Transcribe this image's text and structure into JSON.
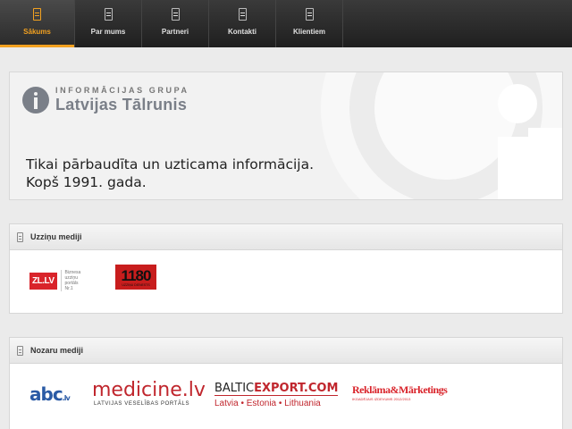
{
  "nav": {
    "items": [
      {
        "label": "Sākums",
        "icon": "page-icon",
        "active": true
      },
      {
        "label": "Par mums",
        "icon": "page-icon"
      },
      {
        "label": "Partneri",
        "icon": "page-icon"
      },
      {
        "label": "Kontakti",
        "icon": "page-icon"
      },
      {
        "label": "Klientiem",
        "icon": "page-icon"
      }
    ],
    "accent": "#f2a120"
  },
  "banner": {
    "logo_sub": "INFORMĀCIJAS GRUPA",
    "logo_main": "Latvijas Tālrunis",
    "slogan_line1": "Tikai pārbaudīta un uzticama informācija.",
    "slogan_line2": "Kopš 1991. gada."
  },
  "panels": {
    "uzzinu": {
      "title": "Uzziņu mediji",
      "zl_logo": "ZL.LV",
      "zl_text_1": "Biznesa",
      "zl_text_2": "uzziņu",
      "zl_text_3": "portāls",
      "zl_text_4": "Nr.1",
      "n1180_logo": "1180",
      "n1180_sub": "UZZIŅU DIENESTS"
    },
    "nozaru": {
      "title": "Nozaru mediji",
      "abc_logo": "abc",
      "abc_lv": ".lv",
      "medicine_logo": "medicine.lv",
      "medicine_sub": "LATVIJAS VESELĪBAS PORTĀLS",
      "baltic_logo_a": "BALTIC",
      "baltic_logo_b": "EXPORT.COM",
      "baltic_sub": "Latvia • Estonia • Lithuania",
      "reklama_logo": "Reklāma&Mārketings",
      "reklama_sub": "IKGADĒJAIS IZDEVUMS 2012/2013"
    }
  }
}
